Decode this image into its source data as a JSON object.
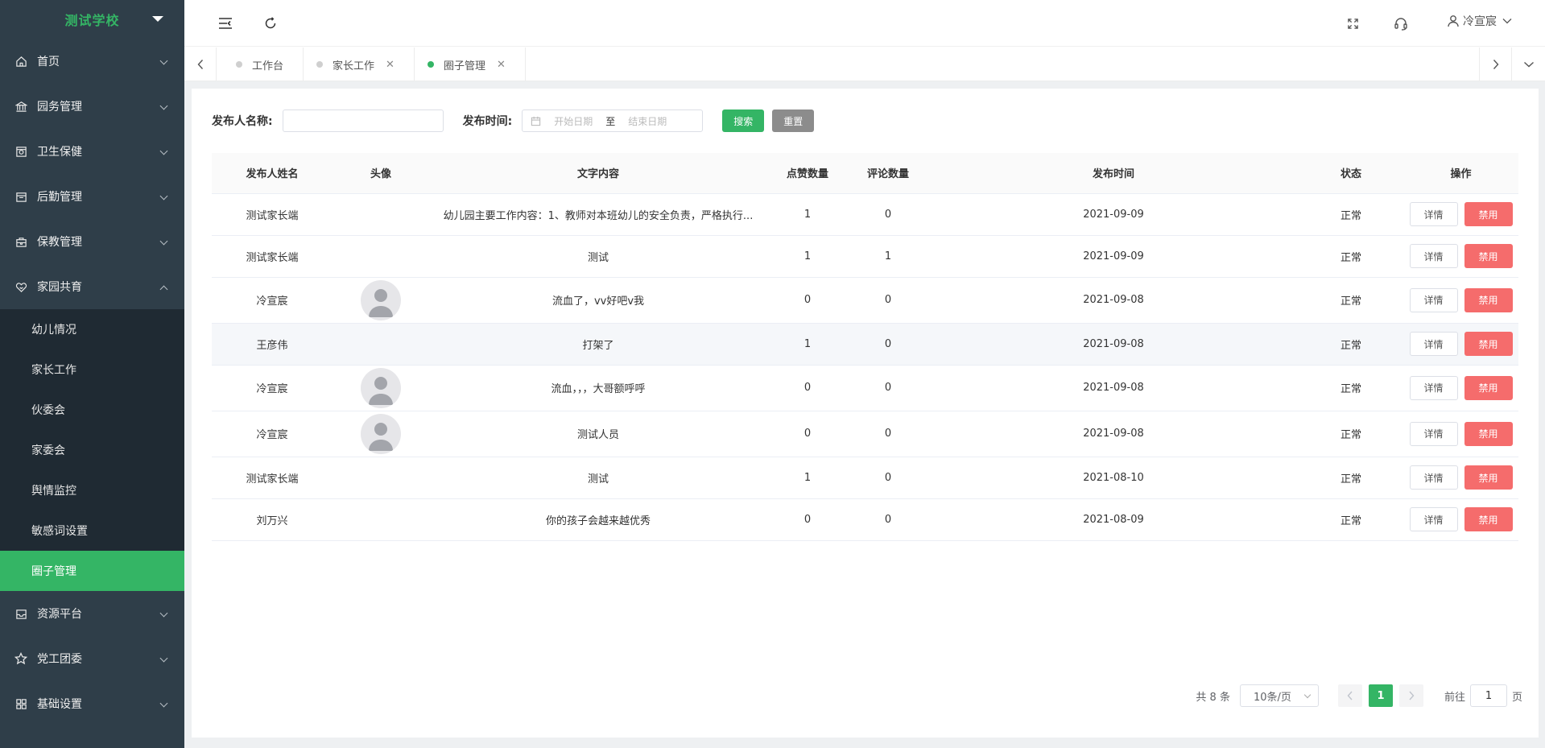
{
  "sidebar": {
    "school": "测试学校",
    "menu": [
      {
        "label": "首页",
        "icon": "home-icon"
      },
      {
        "label": "园务管理",
        "icon": "bank-icon"
      },
      {
        "label": "卫生保健",
        "icon": "safe-icon"
      },
      {
        "label": "后勤管理",
        "icon": "calendar-icon"
      },
      {
        "label": "保教管理",
        "icon": "briefcase-icon"
      },
      {
        "label": "家园共育",
        "icon": "heart-icon",
        "expanded": true
      }
    ],
    "submenu": [
      "幼儿情况",
      "家长工作",
      "伙委会",
      "家委会",
      "舆情监控",
      "敏感词设置",
      "圈子管理"
    ],
    "active_submenu": "圈子管理",
    "menu_bottom": [
      {
        "label": "资源平台",
        "icon": "inbox-icon"
      },
      {
        "label": "党工团委",
        "icon": "star-icon"
      },
      {
        "label": "基础设置",
        "icon": "grid-icon"
      }
    ]
  },
  "header": {
    "user_name": "冷宣宸"
  },
  "tabs": [
    {
      "label": "工作台",
      "closable": false,
      "active": false
    },
    {
      "label": "家长工作",
      "closable": true,
      "active": false
    },
    {
      "label": "圈子管理",
      "closable": true,
      "active": true
    }
  ],
  "filter": {
    "name_label": "发布人名称:",
    "time_label": "发布时间:",
    "start_placeholder": "开始日期",
    "sep": "至",
    "end_placeholder": "结束日期",
    "search": "搜索",
    "reset": "重置"
  },
  "table": {
    "columns": [
      "发布人姓名",
      "头像",
      "文字内容",
      "点赞数量",
      "评论数量",
      "发布时间",
      "状态",
      "操作"
    ],
    "detail_label": "详情",
    "ban_label": "禁用",
    "rows": [
      {
        "name": "测试家长端",
        "avatar": false,
        "content": "幼儿园主要工作内容：1、教师对本班幼儿的安全负责，严格执行...",
        "likes": "1",
        "comments": "0",
        "date": "2021-09-09",
        "status": "正常"
      },
      {
        "name": "测试家长端",
        "avatar": false,
        "content": "测试",
        "likes": "1",
        "comments": "1",
        "date": "2021-09-09",
        "status": "正常"
      },
      {
        "name": "冷宣宸",
        "avatar": true,
        "content": "流血了，vv好吧v我",
        "likes": "0",
        "comments": "0",
        "date": "2021-09-08",
        "status": "正常"
      },
      {
        "name": "王彦伟",
        "avatar": false,
        "content": "打架了",
        "likes": "1",
        "comments": "0",
        "date": "2021-09-08",
        "status": "正常"
      },
      {
        "name": "冷宣宸",
        "avatar": true,
        "content": "流血，，，大哥额呼呼",
        "likes": "0",
        "comments": "0",
        "date": "2021-09-08",
        "status": "正常"
      },
      {
        "name": "冷宣宸",
        "avatar": true,
        "content": "测试人员",
        "likes": "0",
        "comments": "0",
        "date": "2021-09-08",
        "status": "正常"
      },
      {
        "name": "测试家长端",
        "avatar": false,
        "content": "测试",
        "likes": "1",
        "comments": "0",
        "date": "2021-08-10",
        "status": "正常"
      },
      {
        "name": "刘万兴",
        "avatar": false,
        "content": "你的孩子会越来越优秀",
        "likes": "0",
        "comments": "0",
        "date": "2021-08-09",
        "status": "正常"
      }
    ]
  },
  "pagination": {
    "total": "共 8 条",
    "page_size": "10条/页",
    "current": "1",
    "goto_prefix": "前往",
    "goto_value": "1",
    "goto_suffix": "页"
  },
  "colors": {
    "accent": "#34b565",
    "sidebar_bg": "#2f3e49",
    "submenu_bg": "#1f2a33",
    "danger": "#f56c6c"
  }
}
